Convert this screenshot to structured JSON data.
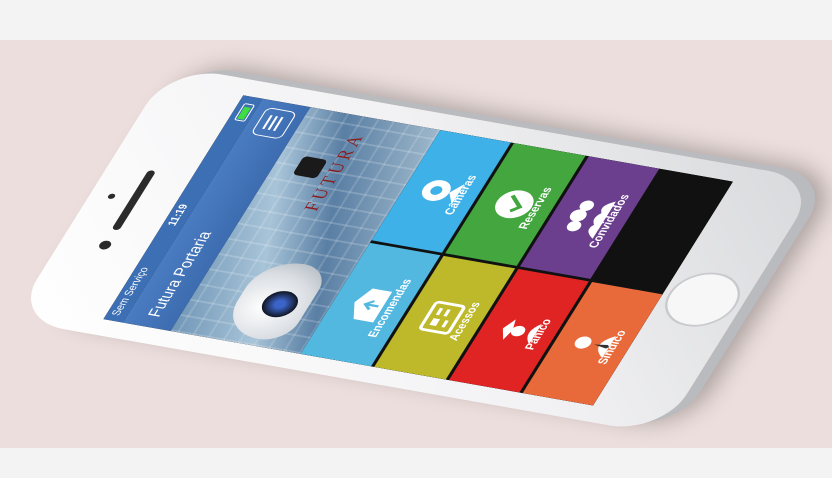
{
  "status_bar": {
    "carrier": "Sem Serviço",
    "time": "11:19",
    "battery_level": 0.85
  },
  "nav": {
    "title": "Futura Portaria"
  },
  "banner": {
    "logo_text": "FUTURA"
  },
  "tiles": [
    {
      "id": "cameras",
      "label": "Câmeras",
      "color": "#3db1e8",
      "icon": "webcam-icon"
    },
    {
      "id": "reservas",
      "label": "Reservas",
      "color": "#43a63f",
      "icon": "checkmark-icon"
    },
    {
      "id": "encomendas",
      "label": "Encomendas",
      "color": "#52b8e0",
      "icon": "package-icon"
    },
    {
      "id": "convidados",
      "label": "Convidados",
      "color": "#6b3f8e",
      "icon": "group-icon"
    },
    {
      "id": "acessos",
      "label": "Acessos",
      "color": "#bdb92a",
      "icon": "access-card-icon"
    },
    {
      "id": "panico",
      "label": "Pânico",
      "color": "#e02424",
      "icon": "police-icon"
    },
    {
      "id": "sindico",
      "label": "Síndico",
      "color": "#e86a3a",
      "icon": "manager-icon"
    }
  ]
}
